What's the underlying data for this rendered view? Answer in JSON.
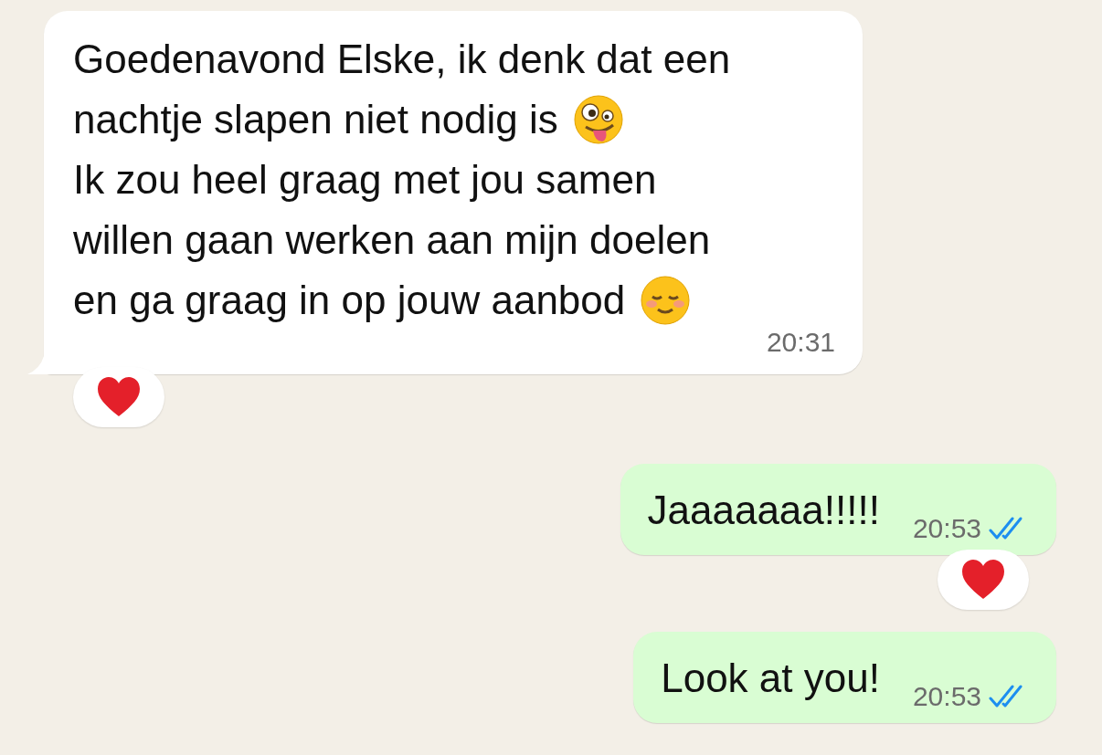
{
  "messages": [
    {
      "kind": "incoming",
      "lines": [
        {
          "text": "Goedenavond Elske, ik denk dat een"
        },
        {
          "text": "nachtje slapen niet nodig is",
          "emoji": {
            "kind": "zany"
          }
        },
        {
          "text": "Ik zou heel graag met jou samen"
        },
        {
          "text": "willen gaan werken aan mijn doelen"
        },
        {
          "text": "en ga graag in op jouw aanbod",
          "emoji": {
            "kind": "smiling"
          }
        }
      ],
      "time": "20:31",
      "reaction": {
        "kind": "heart"
      }
    },
    {
      "kind": "outgoing",
      "lines": [
        {
          "text": "Jaaaaaaa!!!!!"
        }
      ],
      "time": "20:53",
      "read": true,
      "reaction": {
        "kind": "heart"
      }
    },
    {
      "kind": "outgoing",
      "lines": [
        {
          "text": "Look at you!"
        }
      ],
      "time": "20:53",
      "read": true
    }
  ]
}
